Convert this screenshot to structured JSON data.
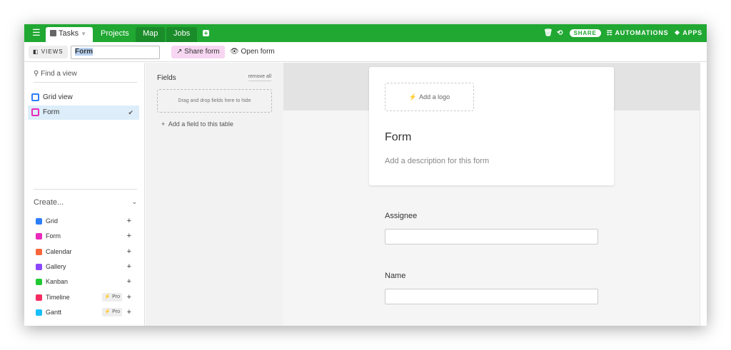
{
  "topbar": {
    "menu_icon": "hamburger-icon",
    "tabs": [
      {
        "label": "Tasks",
        "active": true
      },
      {
        "label": "Projects"
      },
      {
        "label": "Map"
      },
      {
        "label": "Jobs"
      }
    ],
    "share_label": "SHARE",
    "automations_label": "AUTOMATIONS",
    "apps_label": "APPS",
    "accent_color": "#20a832"
  },
  "viewbar": {
    "views_label": "VIEWS",
    "view_name": "Form",
    "share_form_label": "Share form",
    "open_form_label": "Open form"
  },
  "sidebar": {
    "find_placeholder": "Find a view",
    "views": [
      {
        "label": "Grid view",
        "icon": "grid-icon",
        "color": "#2d7ff9"
      },
      {
        "label": "Form",
        "icon": "form-icon",
        "color": "#e929ba",
        "selected": true
      }
    ],
    "create_label": "Create...",
    "create_items": [
      {
        "label": "Grid",
        "color": "#2d7ff9"
      },
      {
        "label": "Form",
        "color": "#e929ba"
      },
      {
        "label": "Calendar",
        "color": "#f7653b"
      },
      {
        "label": "Gallery",
        "color": "#8b46ff"
      },
      {
        "label": "Kanban",
        "color": "#20c933"
      },
      {
        "label": "Timeline",
        "color": "#f82b60",
        "badge": "Pro"
      },
      {
        "label": "Gantt",
        "color": "#18bfff",
        "badge": "Pro"
      }
    ]
  },
  "fields_panel": {
    "title": "Fields",
    "remove_all": "remove all",
    "dropzone_text": "Drag and drop fields here to hide",
    "add_field": "Add a field to this table"
  },
  "form": {
    "add_logo": "Add a logo",
    "title": "Form",
    "description_placeholder": "Add a description for this form",
    "questions": [
      {
        "label": "Assignee"
      },
      {
        "label": "Name"
      }
    ]
  }
}
